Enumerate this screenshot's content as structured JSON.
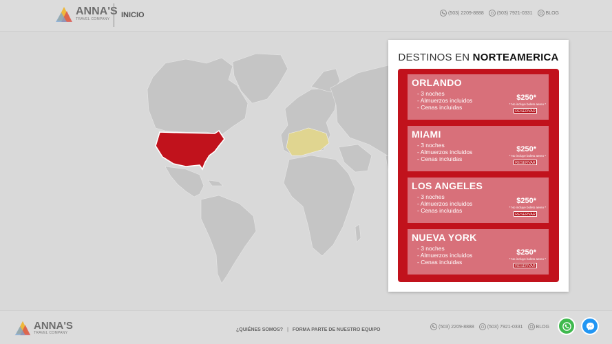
{
  "header": {
    "logo": {
      "brand": "ANNA'S",
      "tagline": "TRAVEL COMPANY"
    },
    "nav": {
      "home": "INICIO"
    },
    "contacts": [
      {
        "icon": "phone-icon",
        "text": "(503) 2209-8888"
      },
      {
        "icon": "whatsapp-icon",
        "text": "(503) 7921-0331"
      },
      {
        "icon": "blog-icon",
        "text": "BLOG"
      }
    ]
  },
  "map": {
    "highlighted_region": "Norteamerica",
    "colors": {
      "ocean": "#d9d9d9",
      "land": "#c5c5c5",
      "highlight": "#c1121c",
      "secondary": "#e0d590"
    }
  },
  "panel": {
    "title_prefix": "DESTINOS EN",
    "title_region": "NORTEAMERICA",
    "destinations": [
      {
        "city": "ORLANDO",
        "features": [
          "- 3 noches",
          "- Almuerzos incluidos",
          "- Cenas incluidas"
        ],
        "price": "$250*",
        "note": "* No incluye boleto aereo *",
        "button": "RESERVAR"
      },
      {
        "city": "MIAMI",
        "features": [
          "- 3 noches",
          "- Almuerzos incluidos",
          "- Cenas incluidas"
        ],
        "price": "$250*",
        "note": "* No incluye boleto aereo *",
        "button": "RESERVAR"
      },
      {
        "city": "LOS ANGELES",
        "features": [
          "- 3 noches",
          "- Almuerzos incluidos",
          "- Cenas incluidas"
        ],
        "price": "$250*",
        "note": "* No incluye boleto aereo *",
        "button": "RESERVAR"
      },
      {
        "city": "NUEVA YORK",
        "features": [
          "- 3 noches",
          "- Almuerzos incluidos",
          "- Cenas incluidas"
        ],
        "price": "$250*",
        "note": "* No incluye boleto aereo *",
        "button": "RESERVAR"
      }
    ]
  },
  "footer": {
    "logo": {
      "brand": "ANNA'S",
      "tagline": "TRAVEL COMPANY"
    },
    "links": [
      "¿QUIÉNES SOMOS?",
      "FORMA PARTE DE NUESTRO EQUIPO"
    ],
    "separator": "|",
    "contacts": [
      {
        "icon": "phone-icon",
        "text": "(503) 2209-8888"
      },
      {
        "icon": "whatsapp-icon",
        "text": "(503) 7921-0331"
      },
      {
        "icon": "blog-icon",
        "text": "BLOG"
      }
    ],
    "chat_buttons": [
      {
        "icon": "whatsapp-icon",
        "color": "#3fb94e"
      },
      {
        "icon": "messenger-icon",
        "color": "#2196f3"
      }
    ]
  }
}
